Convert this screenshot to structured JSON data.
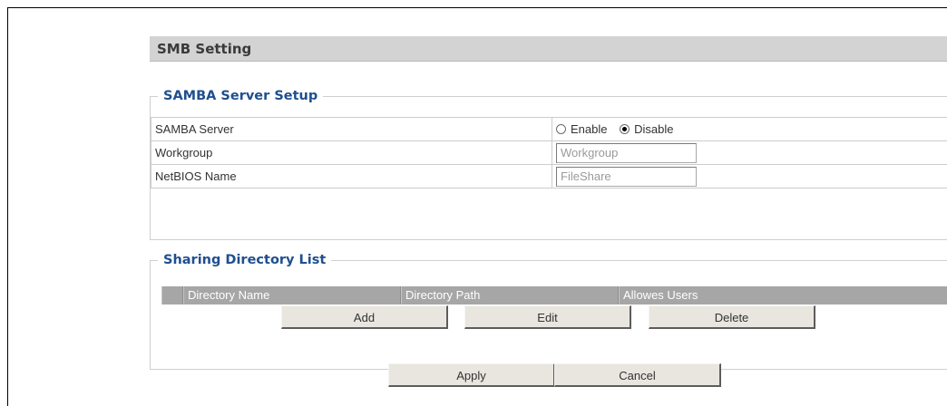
{
  "header": {
    "title": "SMB Setting"
  },
  "samba_setup": {
    "legend": "SAMBA Server Setup",
    "rows": {
      "server": {
        "label": "SAMBA Server",
        "options": [
          "Enable",
          "Disable"
        ],
        "selected": "Disable"
      },
      "workgroup": {
        "label": "Workgroup",
        "value": "Workgroup"
      },
      "netbios": {
        "label": "NetBIOS Name",
        "value": "FileShare"
      }
    }
  },
  "sharing_list": {
    "legend": "Sharing Directory List",
    "columns": [
      "Directory Name",
      "Directory Path",
      "Allowes Users"
    ],
    "buttons": {
      "add": "Add",
      "edit": "Edit",
      "delete": "Delete"
    }
  },
  "footer": {
    "apply": "Apply",
    "cancel": "Cancel"
  }
}
